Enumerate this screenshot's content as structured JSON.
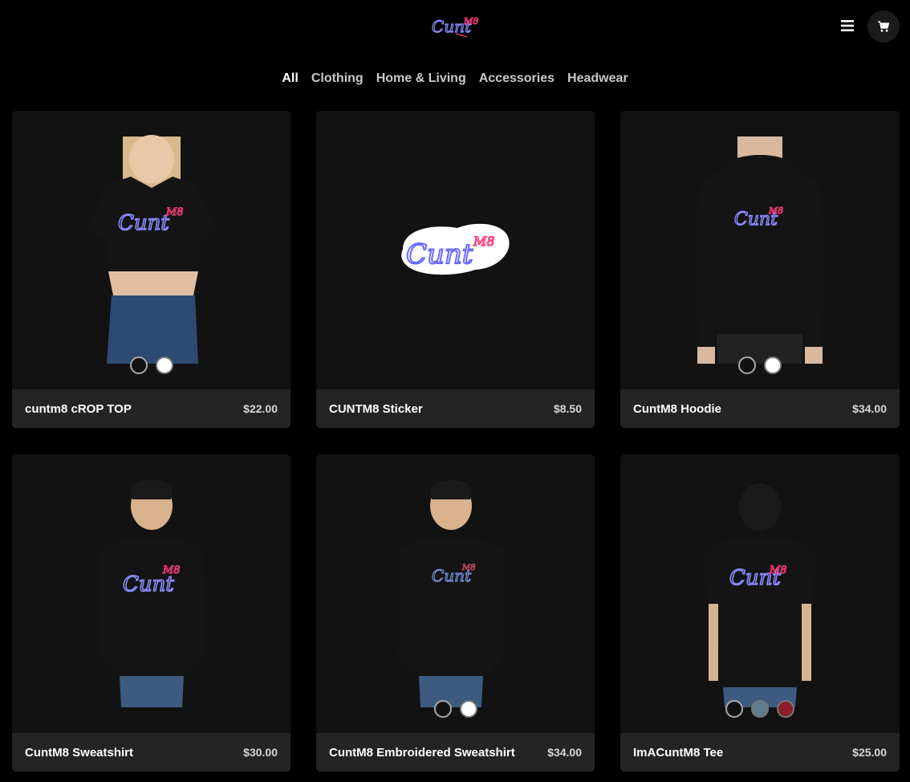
{
  "header": {
    "logo_alt": "CuntM8",
    "icons": {
      "menu": "hamburger-menu-icon",
      "cart": "shopping-cart-icon"
    }
  },
  "nav": {
    "items": [
      {
        "label": "All",
        "active": true
      },
      {
        "label": "Clothing",
        "active": false
      },
      {
        "label": "Home & Living",
        "active": false
      },
      {
        "label": "Accessories",
        "active": false
      },
      {
        "label": "Headwear",
        "active": false
      }
    ]
  },
  "colors": {
    "background": "#000000",
    "card_bg": "#121212",
    "card_footer_bg": "#242424",
    "neon_blue": "#7b7bff",
    "neon_pink": "#ff3b7a"
  },
  "products": [
    {
      "title": "cuntm8 cROP TOP",
      "price": "$22.00",
      "swatches": [
        "#111111",
        "#ffffff"
      ]
    },
    {
      "title": "CUNTM8 Sticker",
      "price": "$8.50",
      "swatches": []
    },
    {
      "title": "CuntM8 Hoodie",
      "price": "$34.00",
      "swatches": [
        "#111111",
        "#ffffff"
      ]
    },
    {
      "title": "CuntM8 Sweatshirt",
      "price": "$30.00",
      "swatches": []
    },
    {
      "title": "CuntM8 Embroidered Sweatshirt",
      "price": "$34.00",
      "swatches": [
        "#111111",
        "#ffffff"
      ]
    },
    {
      "title": "ImACuntM8 Tee",
      "price": "$25.00",
      "swatches": [
        "#111111",
        "#5f7d8c",
        "#8c1e2a"
      ]
    }
  ]
}
